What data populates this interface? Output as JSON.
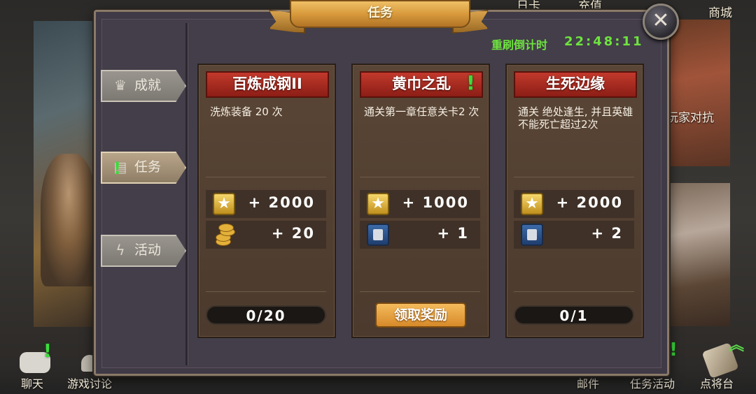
{
  "background": {
    "top_nav": [
      "日卡",
      "充值",
      "商城"
    ],
    "right_panel_label": "玩家对抗",
    "bottom_nav": [
      {
        "label": "聊天"
      },
      {
        "label": "游戏讨论"
      },
      {
        "label": "邮件"
      },
      {
        "label": "任务活动"
      },
      {
        "label": "点将台"
      }
    ]
  },
  "modal": {
    "title": "任务",
    "refresh_label": "重刷倒计时",
    "refresh_time": "22:48:11",
    "tabs": [
      {
        "label": "成就",
        "icon": "crown-icon",
        "active": false
      },
      {
        "label": "任务",
        "icon": "scroll-icon",
        "active": true,
        "alert": "!"
      },
      {
        "label": "活动",
        "icon": "lightning-icon",
        "active": false
      }
    ],
    "quests": [
      {
        "title": "百炼成钢II",
        "description": "洗炼装备 20 次",
        "rewards": [
          {
            "icon": "star-icon",
            "amount": "+ 2000"
          },
          {
            "icon": "coins-icon",
            "amount": "+ 20"
          }
        ],
        "progress": "0/20"
      },
      {
        "title": "黄巾之乱",
        "alert": "!",
        "description": "通关第一章任意关卡2 次",
        "rewards": [
          {
            "icon": "star-icon",
            "amount": "+ 1000"
          },
          {
            "icon": "card-icon",
            "amount": "+ 1"
          }
        ],
        "claim_label": "领取奖励"
      },
      {
        "title": "生死边缘",
        "description": "通关 绝处逢生, 并且英雄不能死亡超过2次",
        "rewards": [
          {
            "icon": "star-icon",
            "amount": "+ 2000"
          },
          {
            "icon": "card-icon",
            "amount": "+ 2"
          }
        ],
        "progress": "0/1"
      }
    ]
  },
  "colors": {
    "green_text": "#6ee33f",
    "card_title_red": "#b0281d",
    "ribbon_gold": "#d89a3c",
    "claim_orange": "#e79b38"
  }
}
